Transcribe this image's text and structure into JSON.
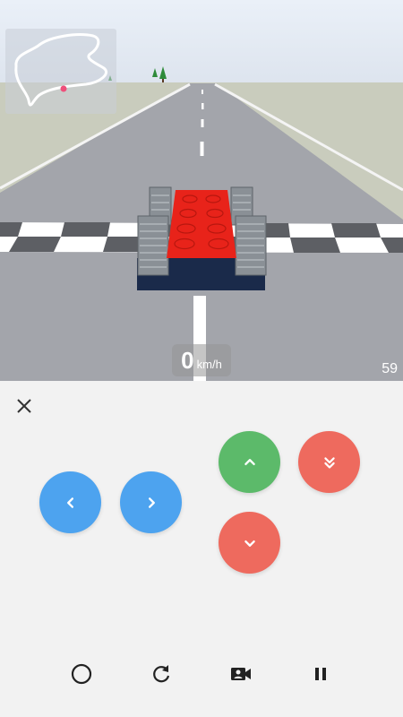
{
  "hud": {
    "speed_value": "0",
    "speed_unit": "km/h",
    "fps": "59"
  },
  "controls": {
    "close_icon": "close-icon",
    "steer_left_icon": "chevron-left-icon",
    "steer_right_icon": "chevron-right-icon",
    "accelerate_icon": "chevron-up-icon",
    "brake_icon": "chevron-down-icon",
    "boost_icon": "double-chevron-down-icon"
  },
  "toolbar": {
    "items": [
      "circle-icon",
      "refresh-icon",
      "video-camera-icon",
      "pause-icon"
    ]
  },
  "colors": {
    "steer_button": "#4da3ef",
    "accelerate_button": "#5cba6a",
    "brake_button": "#ee6a5e",
    "car_body": "#e8231a",
    "sky": "#e3eaf4",
    "road": "#a3a5ab",
    "grass": "#c9ccbd"
  }
}
